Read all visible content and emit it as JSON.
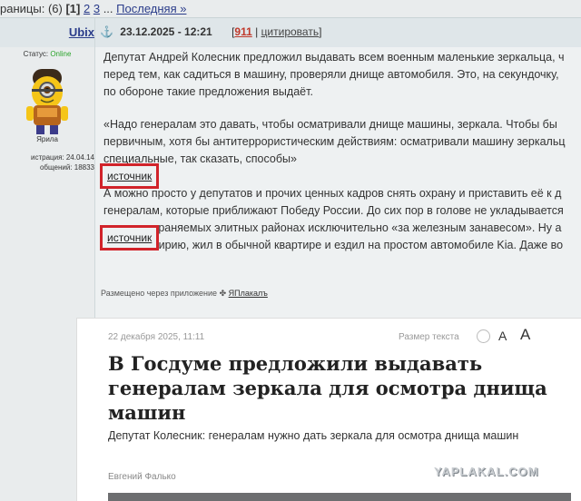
{
  "pager": {
    "prefix": "раницы:",
    "count": "(6)",
    "current": "[1]",
    "pages": [
      "2",
      "3"
    ],
    "ellipsis": "...",
    "last": "Последняя »"
  },
  "user": {
    "name": "Ubix",
    "status_label": "Статус:",
    "status_value": "Online",
    "nick": "Ярила",
    "reg_line": "истрация: 24.04.14",
    "posts_line": "общений: 18833"
  },
  "post": {
    "date": "23.12.2025 - 12:21",
    "rating": "911",
    "cite": "цитировать",
    "paragraphs": [
      "Депутат Андрей Колесник предложил выдавать всем военным маленькие зеркальца, ч",
      "перед тем, как садиться в машину, проверяли днище автомобиля. Это, на секундочку,",
      "по обороне такие предложения выдаёт.",
      "«Надо генералам это давать, чтобы осматривали днище машины, зеркала. Чтобы бы",
      "первичным, хотя бы антитеррористическим действиям: осматривали машину зеркальц",
      "специальные, так сказать, способы»",
      "А можно просто у депутатов и прочих ценных кадров снять охрану и приставить её к д",
      "генералам, которые приближают Победу России. До сих пор в голове не укладывается",
      "живут в охраняемых элитных районах исключительно «за железным занавесом». Ну а",
      "Чечню и Сирию, жил в обычной квартире и ездил на простом автомобиле Kia. Даже во"
    ],
    "source_label": "источник",
    "via_text": "Размещено через приложение",
    "via_app": "ЯПлакалъ"
  },
  "card": {
    "date": "22 декабря 2025, 11:11",
    "size_label": "Размер текста",
    "size_small": "A",
    "size_large": "A",
    "headline": "В Госдуме предложили выдавать генералам зеркала для осмотра днища машин",
    "lead": "Депутат Колесник: генералам нужно дать зеркала для осмотра днища машин",
    "author": "Евгений Фалько"
  },
  "watermark": "YAPLAKAL.COM"
}
